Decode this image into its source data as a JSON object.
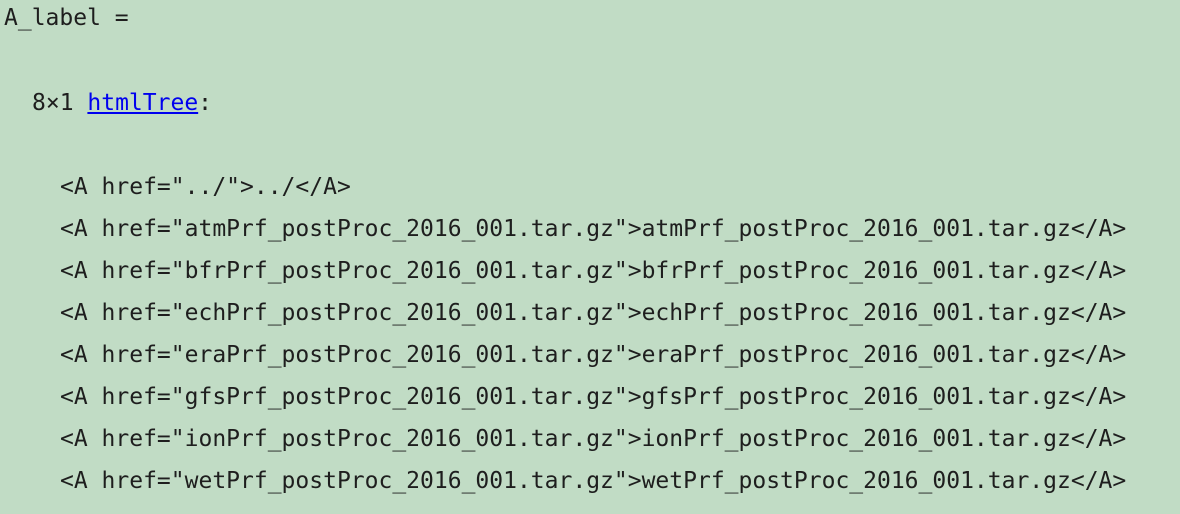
{
  "console": {
    "variable_header": "A_label =",
    "size_prefix": "8×1 ",
    "class_link": "htmlTree",
    "class_suffix": ":",
    "elements": [
      "<A href=\"../\">../</A>",
      "<A href=\"atmPrf_postProc_2016_001.tar.gz\">atmPrf_postProc_2016_001.tar.gz</A>",
      "<A href=\"bfrPrf_postProc_2016_001.tar.gz\">bfrPrf_postProc_2016_001.tar.gz</A>",
      "<A href=\"echPrf_postProc_2016_001.tar.gz\">echPrf_postProc_2016_001.tar.gz</A>",
      "<A href=\"eraPrf_postProc_2016_001.tar.gz\">eraPrf_postProc_2016_001.tar.gz</A>",
      "<A href=\"gfsPrf_postProc_2016_001.tar.gz\">gfsPrf_postProc_2016_001.tar.gz</A>",
      "<A href=\"ionPrf_postProc_2016_001.tar.gz\">ionPrf_postProc_2016_001.tar.gz</A>",
      "<A href=\"wetPrf_postProc_2016_001.tar.gz\">wetPrf_postProc_2016_001.tar.gz</A>"
    ]
  },
  "colors": {
    "background": "#c1dcc5",
    "text": "#1e1e1e",
    "link": "#0000ee"
  }
}
